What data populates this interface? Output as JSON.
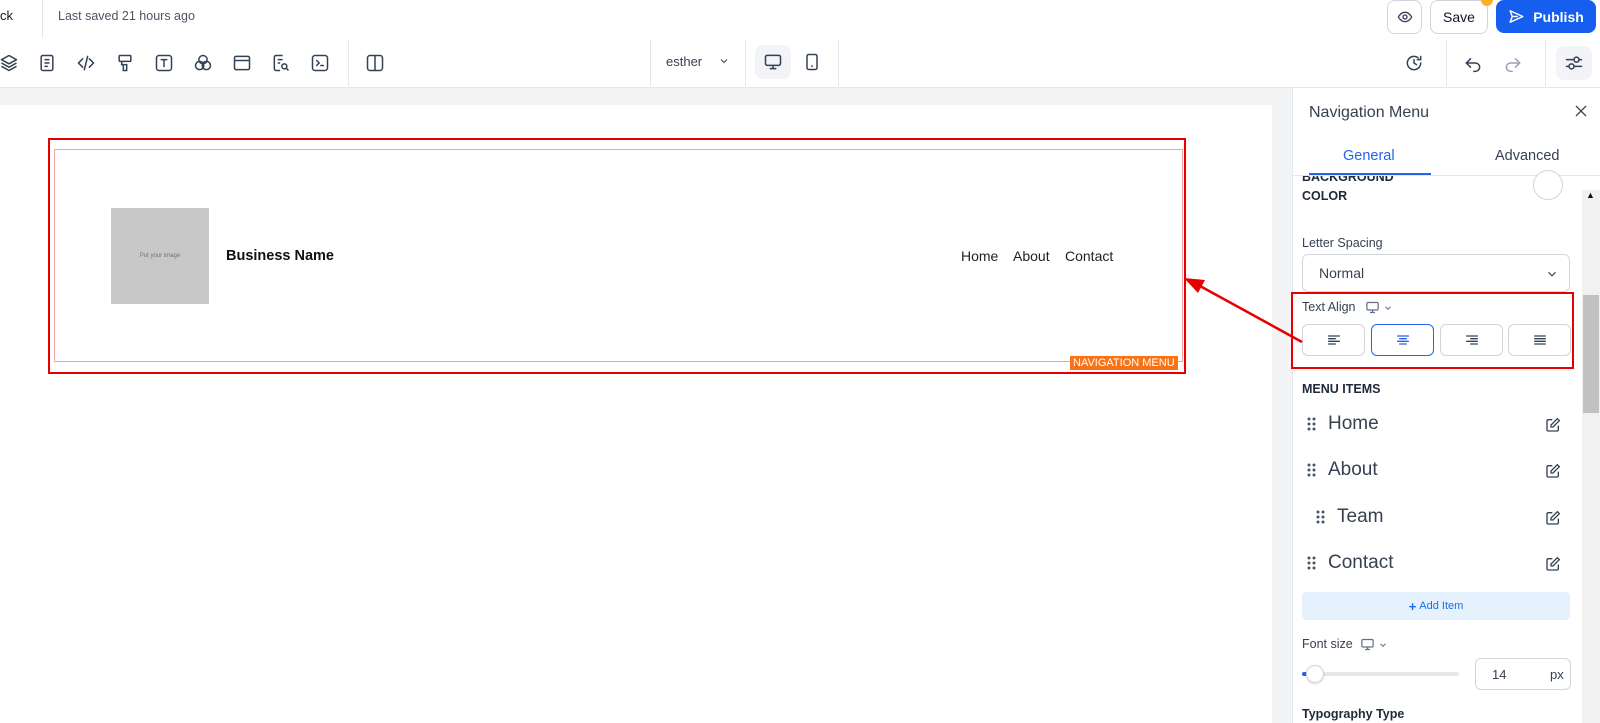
{
  "topbar": {
    "back_label": "ck",
    "saved_text": "Last saved 21 hours ago",
    "save_label": "Save",
    "publish_label": "Publish"
  },
  "toolbar": {
    "page_selector": "esther",
    "icons": [
      "layers-icon",
      "page-icon",
      "code-icon",
      "paint-roller-icon",
      "text-icon",
      "shapes-icon",
      "section-icon",
      "seo-search-icon",
      "terminal-icon",
      "layout-columns-icon"
    ]
  },
  "canvas": {
    "logo_placeholder": "Put your image",
    "business_name": "Business Name",
    "nav_links": [
      "Home",
      "About",
      "Contact"
    ],
    "selection_tag": "NAVIGATION MENU"
  },
  "panel": {
    "title": "Navigation Menu",
    "tabs": [
      {
        "label": "General",
        "active": true
      },
      {
        "label": "Advanced",
        "active": false
      }
    ],
    "cut_off_header": "BACKGROUND",
    "color_header": "COLOR",
    "letter_spacing_label": "Letter Spacing",
    "letter_spacing_value": "Normal",
    "text_align_label": "Text Align",
    "text_align_active": "center",
    "menu_items_header": "MENU ITEMS",
    "menu_items": [
      {
        "label": "Home",
        "indent": false
      },
      {
        "label": "About",
        "indent": false
      },
      {
        "label": "Team",
        "indent": true
      },
      {
        "label": "Contact",
        "indent": false
      }
    ],
    "add_item_label": "Add Item",
    "font_size_label": "Font size",
    "font_size_value": "14",
    "font_size_unit": "px",
    "typography_label": "Typography Type"
  },
  "colors": {
    "accent": "#2563eb",
    "publish": "#155eef",
    "highlight_red": "#e60000",
    "tag_orange": "#f97316"
  }
}
